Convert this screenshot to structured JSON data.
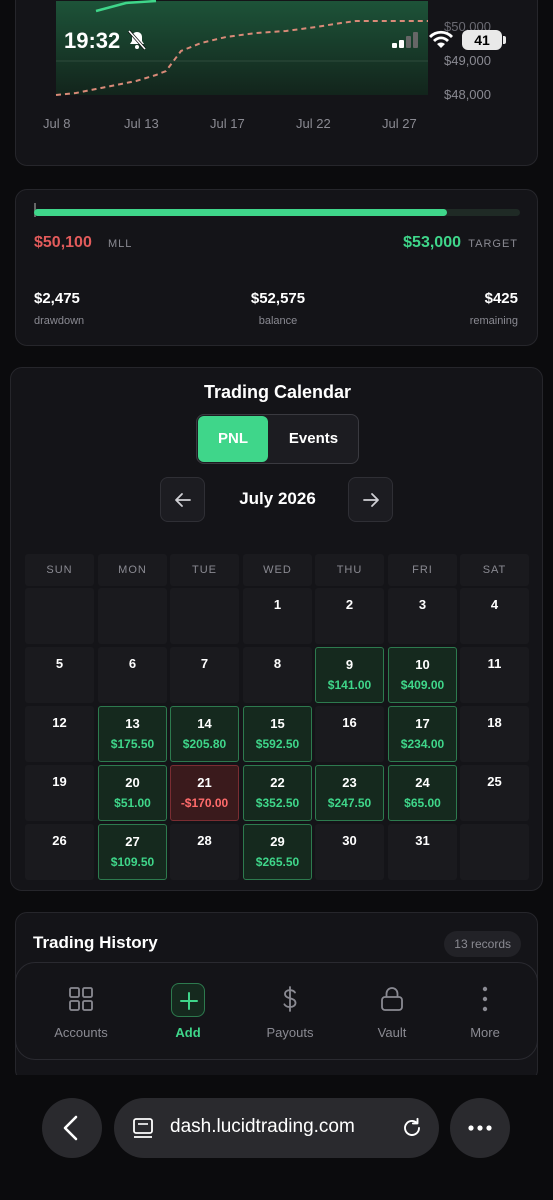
{
  "status_bar": {
    "time": "19:32",
    "battery": "41"
  },
  "chart": {
    "y_labels": [
      "$50,000",
      "$49,000",
      "$48,000"
    ],
    "x_labels": [
      "Jul 8",
      "Jul 13",
      "Jul 17",
      "Jul 22",
      "Jul 27"
    ]
  },
  "progress": {
    "mll_value": "$50,100",
    "mll_label": "MLL",
    "target_value": "$53,000",
    "target_label": "TARGET",
    "fill_fraction": 0.85,
    "stats": [
      {
        "value": "$2,475",
        "label": "drawdown"
      },
      {
        "value": "$52,575",
        "label": "balance"
      },
      {
        "value": "$425",
        "label": "remaining"
      }
    ]
  },
  "calendar": {
    "title": "Trading Calendar",
    "toggle_pnl": "PNL",
    "toggle_events": "Events",
    "month": "July 2026",
    "weekdays": [
      "SUN",
      "MON",
      "TUE",
      "WED",
      "THU",
      "FRI",
      "SAT"
    ],
    "days": [
      {
        "day": "",
        "pnl": "",
        "type": "empty"
      },
      {
        "day": "",
        "pnl": "",
        "type": "empty"
      },
      {
        "day": "",
        "pnl": "",
        "type": "empty"
      },
      {
        "day": "1",
        "pnl": "",
        "type": "none"
      },
      {
        "day": "2",
        "pnl": "",
        "type": "none"
      },
      {
        "day": "3",
        "pnl": "",
        "type": "none"
      },
      {
        "day": "4",
        "pnl": "",
        "type": "none"
      },
      {
        "day": "5",
        "pnl": "",
        "type": "none"
      },
      {
        "day": "6",
        "pnl": "",
        "type": "none"
      },
      {
        "day": "7",
        "pnl": "",
        "type": "none"
      },
      {
        "day": "8",
        "pnl": "",
        "type": "none"
      },
      {
        "day": "9",
        "pnl": "$141.00",
        "type": "pos"
      },
      {
        "day": "10",
        "pnl": "$409.00",
        "type": "pos"
      },
      {
        "day": "11",
        "pnl": "",
        "type": "none"
      },
      {
        "day": "12",
        "pnl": "",
        "type": "none"
      },
      {
        "day": "13",
        "pnl": "$175.50",
        "type": "pos"
      },
      {
        "day": "14",
        "pnl": "$205.80",
        "type": "pos"
      },
      {
        "day": "15",
        "pnl": "$592.50",
        "type": "pos"
      },
      {
        "day": "16",
        "pnl": "",
        "type": "none"
      },
      {
        "day": "17",
        "pnl": "$234.00",
        "type": "pos"
      },
      {
        "day": "18",
        "pnl": "",
        "type": "none"
      },
      {
        "day": "19",
        "pnl": "",
        "type": "none"
      },
      {
        "day": "20",
        "pnl": "$51.00",
        "type": "pos"
      },
      {
        "day": "21",
        "pnl": "-$170.00",
        "type": "neg"
      },
      {
        "day": "22",
        "pnl": "$352.50",
        "type": "pos"
      },
      {
        "day": "23",
        "pnl": "$247.50",
        "type": "pos"
      },
      {
        "day": "24",
        "pnl": "$65.00",
        "type": "pos"
      },
      {
        "day": "25",
        "pnl": "",
        "type": "none"
      },
      {
        "day": "26",
        "pnl": "",
        "type": "none"
      },
      {
        "day": "27",
        "pnl": "$109.50",
        "type": "pos"
      },
      {
        "day": "28",
        "pnl": "",
        "type": "none"
      },
      {
        "day": "29",
        "pnl": "$265.50",
        "type": "pos"
      },
      {
        "day": "30",
        "pnl": "",
        "type": "none"
      },
      {
        "day": "31",
        "pnl": "",
        "type": "none"
      },
      {
        "day": "",
        "pnl": "",
        "type": "empty"
      }
    ]
  },
  "history": {
    "title": "Trading History",
    "records": "13 records"
  },
  "tabbar": {
    "items": [
      {
        "label": "Accounts",
        "icon": "grid-icon"
      },
      {
        "label": "Add",
        "icon": "plus-icon"
      },
      {
        "label": "Payouts",
        "icon": "dollar-icon"
      },
      {
        "label": "Vault",
        "icon": "lock-icon"
      },
      {
        "label": "More",
        "icon": "more-vertical-icon"
      }
    ]
  },
  "browser": {
    "url": "dash.lucidtrading.com"
  },
  "colors": {
    "accent": "#3fd68a",
    "negative": "#e25b5b",
    "background": "#0b0b0d",
    "card": "#141418"
  }
}
